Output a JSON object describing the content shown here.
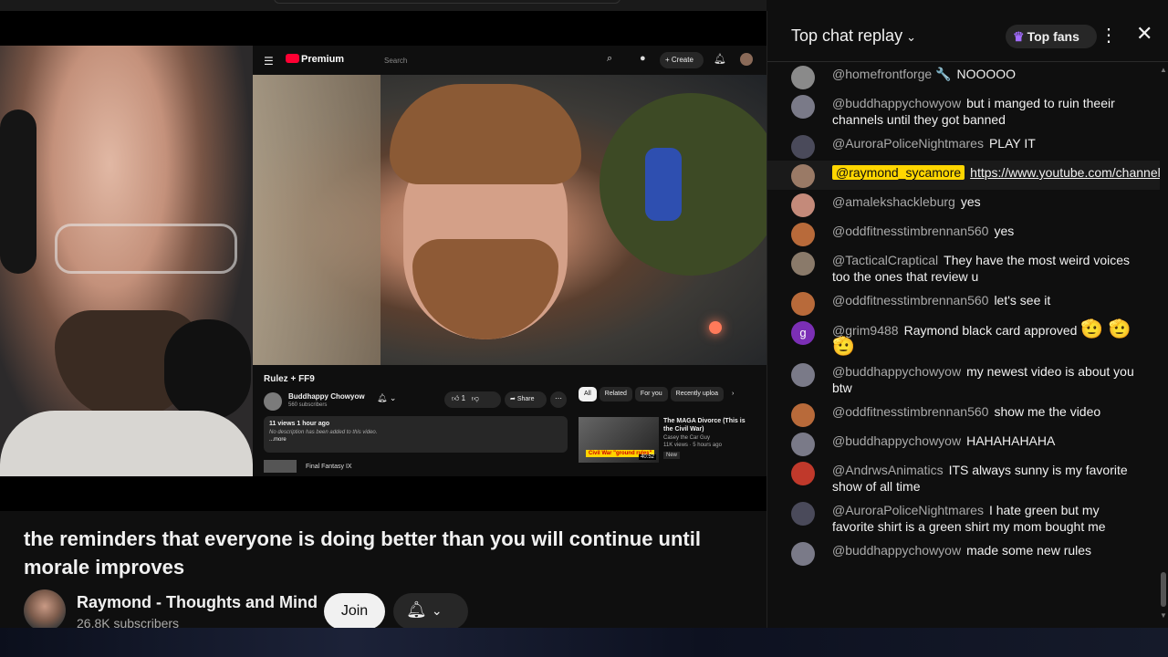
{
  "inner_youtube": {
    "logo": "Premium",
    "search_placeholder": "Search",
    "create_label": "+ Create",
    "video_title": "Rulez + FF9",
    "channel_name": "Buddhappy Chowyow",
    "channel_subs": "560 subscribers",
    "like_count": "1",
    "share_label": "Share",
    "views": "11 views  1 hour ago",
    "no_desc": "No description has been added to this video.",
    "more": "...more",
    "next_item": "Final Fantasy IX",
    "chips": [
      "All",
      "Related",
      "For you",
      "Recently uploa"
    ],
    "rec_title": "The MAGA Divorce (This is the Civil War)",
    "rec_channel": "Casey the Car Guy",
    "rec_meta": "11K views · 5 hours ago",
    "rec_new": "New",
    "rec_tag": "Civil War \"ground rules\"",
    "rec_duration": "40:52"
  },
  "video": {
    "title": "the reminders that everyone is doing better than you will continue until morale improves",
    "channel": "Raymond - Thoughts and Mind",
    "subscribers": "26.8K subscribers",
    "join_label": "Join"
  },
  "chat": {
    "title": "Top chat replay",
    "top_fans_label": "Top fans",
    "messages": [
      {
        "author": "@homefrontforge 🔧",
        "text": "NOOOOO",
        "avatar": "#8a8a8a"
      },
      {
        "author": "@buddhappychowyow",
        "text": "but i manged to ruin theeir channels until they got banned",
        "avatar": "#7a7a88"
      },
      {
        "author": "@AuroraPoliceNightmares",
        "text": "PLAY IT",
        "avatar": "#4a4a5a"
      },
      {
        "author": "@raymond_sycamore",
        "link": "https://www.youtube.com/channel/UCPQm...",
        "avatar": "#9a7a66"
      },
      {
        "author": "@amalekshackleburg",
        "text": "yes",
        "avatar": "#c48a7a"
      },
      {
        "author": "@oddfitnesstimbrennan560",
        "text": "yes",
        "avatar": "#b86a3a"
      },
      {
        "author": "@TacticalCraptical",
        "text": "They have the most weird voices too the ones that review u",
        "avatar": "#8a7a6a"
      },
      {
        "author": "@oddfitnesstimbrennan560",
        "text": "let's see it",
        "avatar": "#b86a3a"
      },
      {
        "author": "@grim9488",
        "text": "Raymond black card approved",
        "emoji": "🫡 🫡 🫡",
        "avatar": "#7b2fb5",
        "initial": "g"
      },
      {
        "author": "@buddhappychowyow",
        "text": "my newest video is about you btw",
        "avatar": "#7a7a88"
      },
      {
        "author": "@oddfitnesstimbrennan560",
        "text": "show me the video",
        "avatar": "#b86a3a"
      },
      {
        "author": "@buddhappychowyow",
        "text": "HAHAHAHAHA",
        "avatar": "#7a7a88"
      },
      {
        "author": "@AndrwsAnimatics",
        "text": "ITS always sunny is my favorite show of all time",
        "avatar": "#c0392b"
      },
      {
        "author": "@AuroraPoliceNightmares",
        "text": "I hate green but my favorite shirt is a green shirt my mom bought me",
        "avatar": "#4a4a5a"
      },
      {
        "author": "@buddhappychowyow",
        "text": "made some new rules",
        "avatar": "#7a7a88"
      }
    ]
  }
}
